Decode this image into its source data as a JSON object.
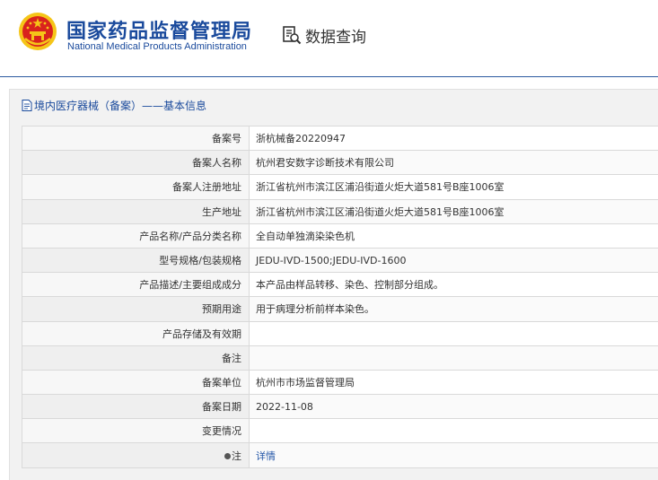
{
  "header": {
    "org_name_cn": "国家药品监督管理局",
    "org_name_en": "National Medical Products Administration",
    "query_label": "数据查询",
    "emblem_icon": "national-emblem-icon",
    "query_icon": "search-document-icon"
  },
  "section": {
    "title": "境内医疗器械（备案）——基本信息",
    "icon": "document-icon"
  },
  "rows": [
    {
      "label": "备案号",
      "value": "浙杭械备20220947"
    },
    {
      "label": "备案人名称",
      "value": "杭州君安数字诊断技术有限公司"
    },
    {
      "label": "备案人注册地址",
      "value": "浙江省杭州市滨江区浦沿街道火炬大道581号B座1006室"
    },
    {
      "label": "生产地址",
      "value": "浙江省杭州市滨江区浦沿街道火炬大道581号B座1006室"
    },
    {
      "label": "产品名称/产品分类名称",
      "value": "全自动单独滴染染色机"
    },
    {
      "label": "型号规格/包装规格",
      "value": "JEDU-IVD-1500;JEDU-IVD-1600"
    },
    {
      "label": "产品描述/主要组成成分",
      "value": "本产品由样品转移、染色、控制部分组成。"
    },
    {
      "label": "预期用途",
      "value": "用于病理分析前样本染色。"
    },
    {
      "label": "产品存储及有效期",
      "value": ""
    },
    {
      "label": "备注",
      "value": ""
    },
    {
      "label": "备案单位",
      "value": "杭州市市场监督管理局"
    },
    {
      "label": "备案日期",
      "value": "2022-11-08"
    },
    {
      "label": "变更情况",
      "value": ""
    },
    {
      "label": "注",
      "value": "详情"
    }
  ],
  "colors": {
    "brand_blue": "#1a4a9c",
    "link_blue": "#2457a8",
    "emblem_red": "#d9231d",
    "emblem_gold": "#f5c518"
  }
}
